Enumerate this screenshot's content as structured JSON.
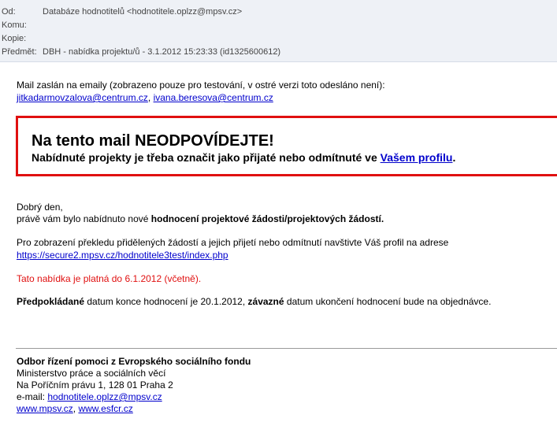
{
  "header": {
    "from_label": "Od:",
    "from_value": "Databáze hodnotitelů <hodnotitele.oplzz@mpsv.cz>",
    "to_label": "Komu:",
    "to_value": "",
    "cc_label": "Kopie:",
    "cc_value": "",
    "subject_label": "Předmět:",
    "subject_value": "DBH - nabídka projektu/ů - 3.1.2012 15:23:33 (id1325600612)"
  },
  "intro": {
    "text": "Mail zaslán na emaily (zobrazeno pouze pro testování, v ostré verzi toto odesláno není):",
    "email1": "jitkadarmovzalova@centrum.cz",
    "separator": ", ",
    "email2": "ivana.beresova@centrum.cz"
  },
  "warning": {
    "title": "Na tento mail NEODPOVÍDEJTE!",
    "text_before": "Nabídnuté projekty je třeba označit jako přijaté nebo odmítnuté ve ",
    "link": "Vašem profilu",
    "text_after": "."
  },
  "message": {
    "greeting": "Dobrý den,",
    "line2_before": "právě vám bylo nabídnuto nové ",
    "line2_bold": "hodnocení projektové žádosti/projektových žádostí.",
    "info": "Pro zobrazení překledu přidělených žádostí a jejich přijetí nebo odmítnutí navštivte Váš profil na adrese",
    "profile_url": "https://secure2.mpsv.cz/hodnotitele3test/index.php",
    "validity": "Tato nabídka je platná do 6.1.2012 (včetně).",
    "deadline_bold1": "Předpokládané",
    "deadline_mid": " datum konce hodnocení je 20.1.2012, ",
    "deadline_bold2": "závazné",
    "deadline_end": " datum ukončení hodnocení bude na objednávce."
  },
  "signature": {
    "dept": "Odbor řízení pomoci z Evropského sociálního fondu",
    "ministry": "Ministerstvo práce a sociálních věcí",
    "address": "Na Poříčním právu 1, 128 01 Praha 2",
    "email_label": "e-mail: ",
    "email": "hodnotitele.oplzz@mpsv.cz",
    "web1": "www.mpsv.cz",
    "web_sep": ", ",
    "web2": "www.esfcr.cz"
  },
  "colors": {
    "warning_border": "#e01010",
    "link": "#0000cc",
    "header_bg": "#eef1f6"
  }
}
